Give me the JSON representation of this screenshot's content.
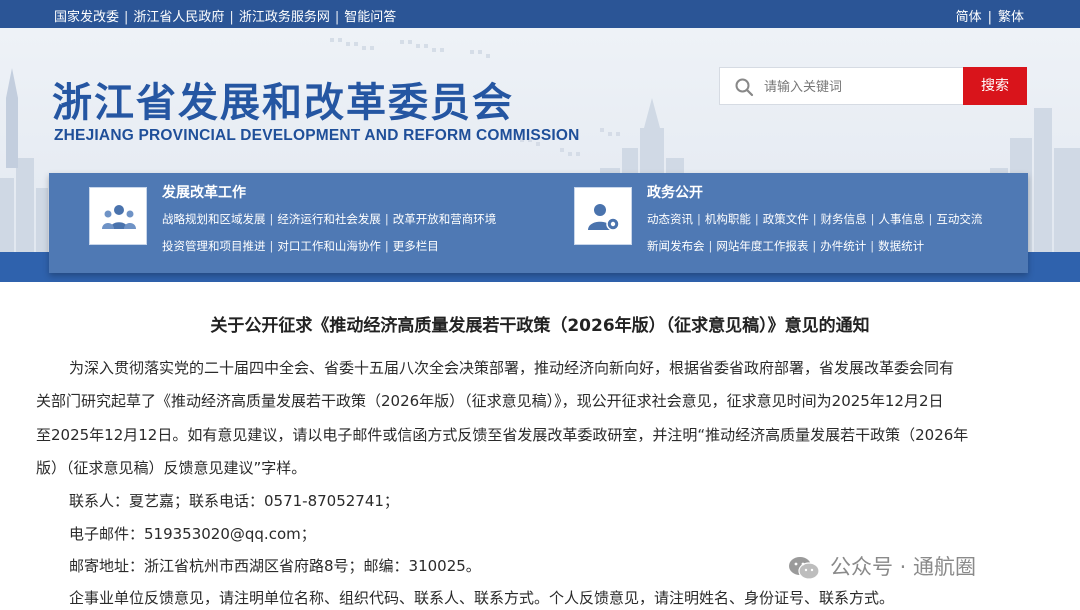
{
  "topbar": {
    "links": [
      "国家发改委",
      "浙江省人民政府",
      "浙江政务服务网",
      "智能问答"
    ],
    "lang": [
      "简体",
      "繁体"
    ]
  },
  "header": {
    "title": "浙江省发展和改革委员会",
    "subtitle": "ZHEJIANG PROVINCIAL DEVELOPMENT AND REFORM COMMISSION"
  },
  "search": {
    "placeholder": "请输入关键词",
    "button": "搜索"
  },
  "nav": {
    "left": {
      "title": "发展改革工作",
      "row1": [
        "战略规划和区域发展",
        "经济运行和社会发展",
        "改革开放和营商环境"
      ],
      "row2": [
        "投资管理和项目推进",
        "对口工作和山海协作",
        "更多栏目"
      ]
    },
    "right": {
      "title": "政务公开",
      "row1": [
        "动态资讯",
        "机构职能",
        "政策文件",
        "财务信息",
        "人事信息",
        "互动交流"
      ],
      "row2": [
        "新闻发布会",
        "网站年度工作报表",
        "办件统计",
        "数据统计"
      ]
    }
  },
  "article": {
    "title": "关于公开征求《推动经济高质量发展若干政策（2026年版）（征求意见稿）》意见的通知",
    "lines": [
      "为深入贯彻落实党的二十届四中全会、省委十五届八次全会决策部署，推动经济向新向好，根据省委省政府部署，省发展改革委会同有",
      "关部门研究起草了《推动经济高质量发展若干政策（2026年版）（征求意见稿）》，现公开征求社会意见，征求意见时间为2025年12月2日",
      "至2025年12月12日。如有意见建议，请以电子邮件或信函方式反馈至省发展改革委政研室，并注明“推动经济高质量发展若干政策（2026年",
      "版）（征求意见稿）反馈意见建议”字样。"
    ],
    "contact": "联系人：夏艺嘉；联系电话：0571-87052741；",
    "email": "电子邮件：519353020@qq.com；",
    "address": "邮寄地址：浙江省杭州市西湖区省府路8号；邮编：310025。",
    "feedback": "企事业单位反馈意见，请注明单位名称、组织代码、联系人、联系方式。个人反馈意见，请注明姓名、身份证号、联系方式。"
  },
  "watermark": "公众号 · 通航圈",
  "colors": {
    "topbar": "#2b5596",
    "title": "#2556a2",
    "navpanel": "#4f79b4",
    "search_button": "#d9141b"
  }
}
